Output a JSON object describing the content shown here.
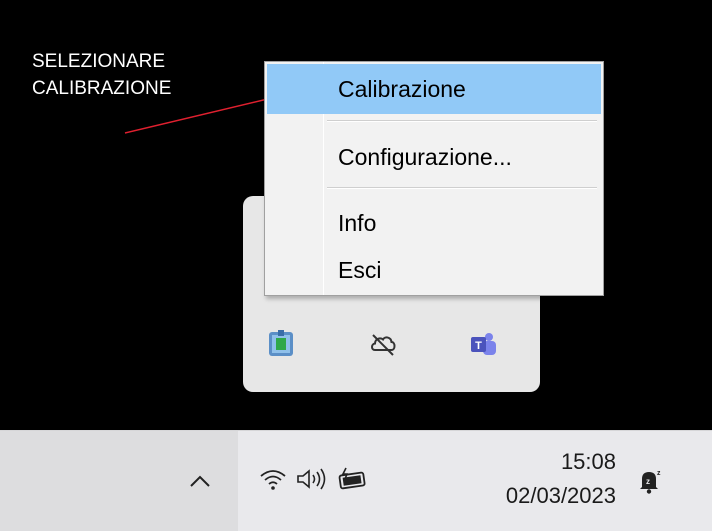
{
  "annotation": {
    "line1": "SELEZIONARE",
    "line2": "CALIBRAZIONE",
    "line_color": "#e0202f"
  },
  "context_menu": {
    "items": [
      {
        "label": "Calibrazione",
        "highlighted": true
      },
      {
        "label": "Configurazione..."
      },
      {
        "label": "Info"
      },
      {
        "label": "Esci"
      }
    ],
    "highlight_color": "#91c9f7"
  },
  "tray_overflow": {
    "icons": [
      "calibration-app-icon",
      "onedrive-offline-icon",
      "teams-icon"
    ]
  },
  "taskbar": {
    "icons": [
      "chevron-up-icon",
      "wifi-icon",
      "speaker-icon",
      "battery-charging-icon",
      "notification-bell-icon"
    ],
    "time": "15:08",
    "date": "02/03/2023"
  }
}
